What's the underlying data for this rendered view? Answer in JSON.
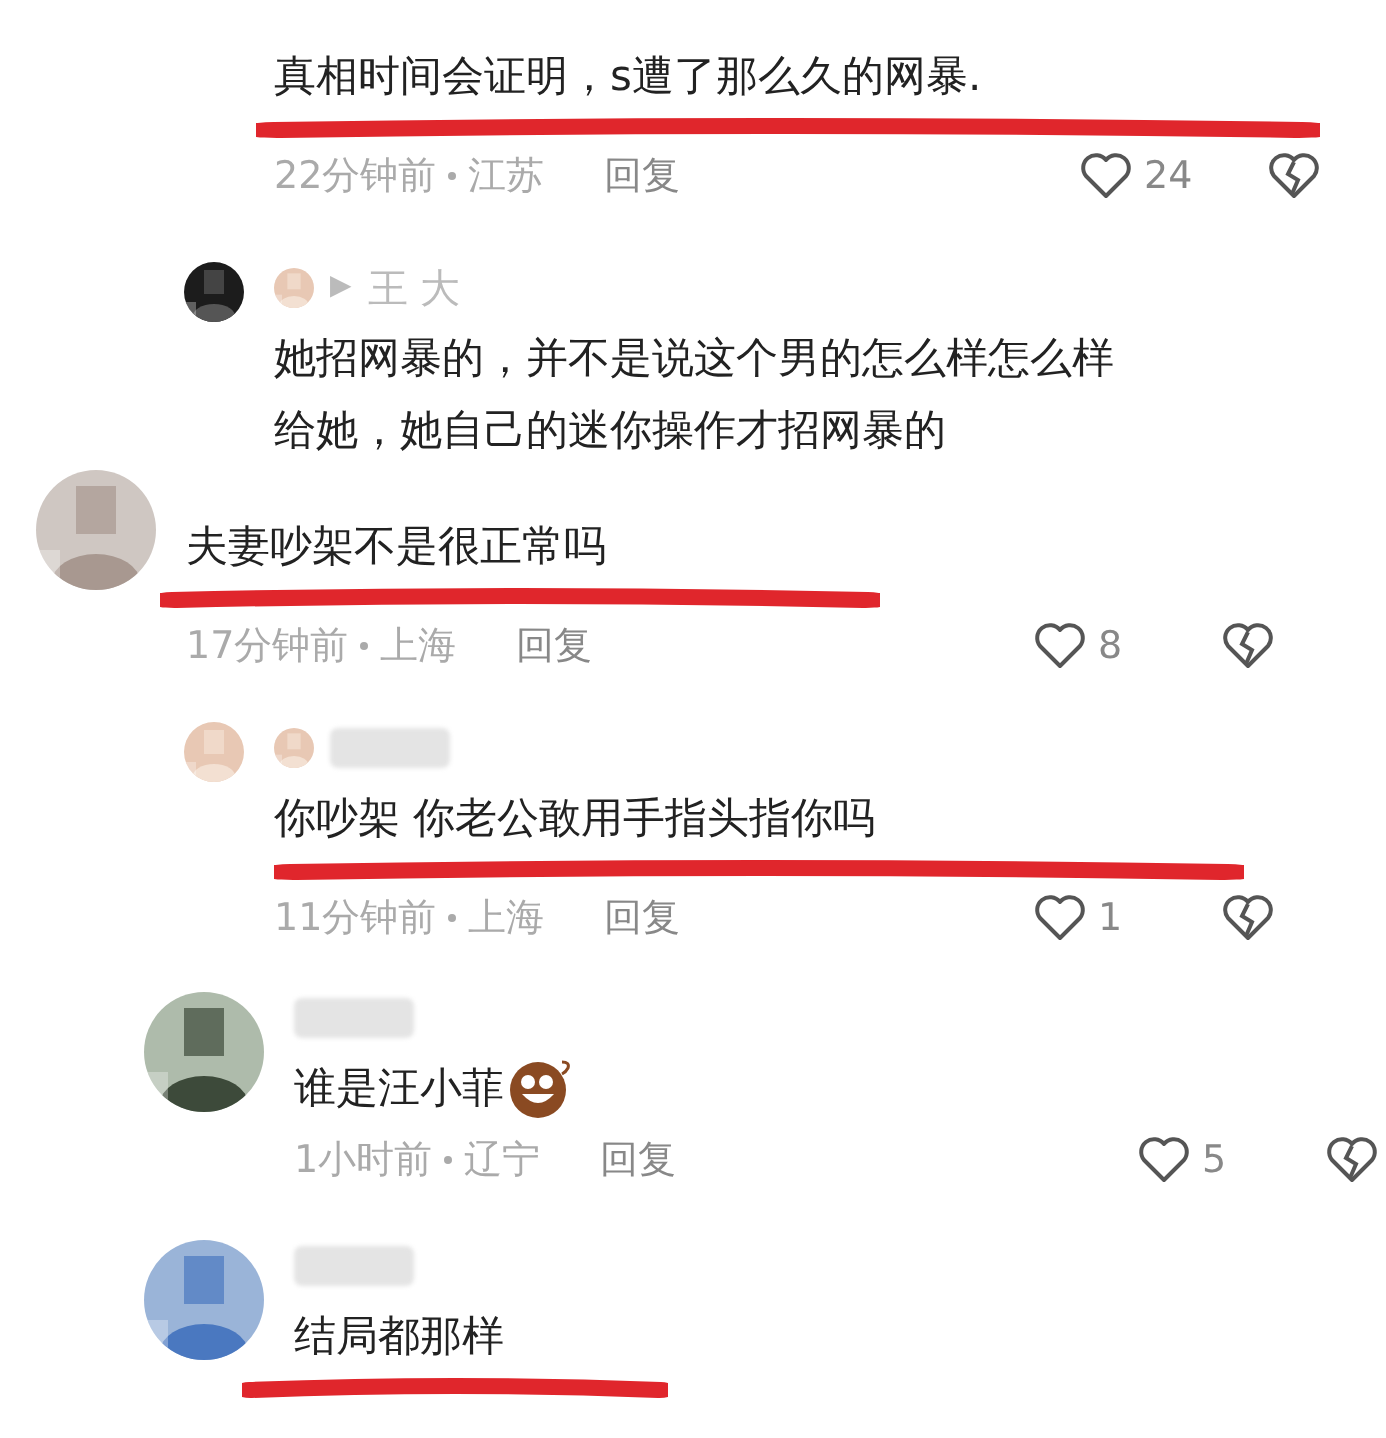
{
  "comments": [
    {
      "kind": "continued",
      "blurred_name": false,
      "text": "真相时间会证明，s遭了那么久的网暴.",
      "underlined": true,
      "meta": {
        "time": "22分钟前",
        "location": "江苏",
        "reply": "回复",
        "likes": "24"
      }
    },
    {
      "kind": "reply",
      "blurred_name": false,
      "author": {
        "arrow": "▶",
        "name": "王 大"
      },
      "text": "她招网暴的，并不是说这个男的怎么样怎么样给她，她自己的迷你操作才招网暴的",
      "underlined": false
    },
    {
      "kind": "cropped-comment",
      "blurred_name": false,
      "text": "夫妻吵架不是很正常吗",
      "underlined": true,
      "meta": {
        "time": "17分钟前",
        "location": "上海",
        "reply": "回复",
        "likes": "8"
      }
    },
    {
      "kind": "reply",
      "blurred_name": true,
      "text": "你吵架 你老公敢用手指头指你吗",
      "underlined": true,
      "meta": {
        "time": "11分钟前",
        "location": "上海",
        "reply": "回复",
        "likes": "1"
      }
    },
    {
      "kind": "comment",
      "blurred_name": true,
      "text": "谁是汪小菲",
      "emoji": true,
      "underlined": false,
      "meta": {
        "time": "1小时前",
        "location": "辽宁",
        "reply": "回复",
        "likes": "5"
      }
    },
    {
      "kind": "comment",
      "blurred_name": true,
      "text": "结局都那样",
      "underlined": true
    }
  ]
}
